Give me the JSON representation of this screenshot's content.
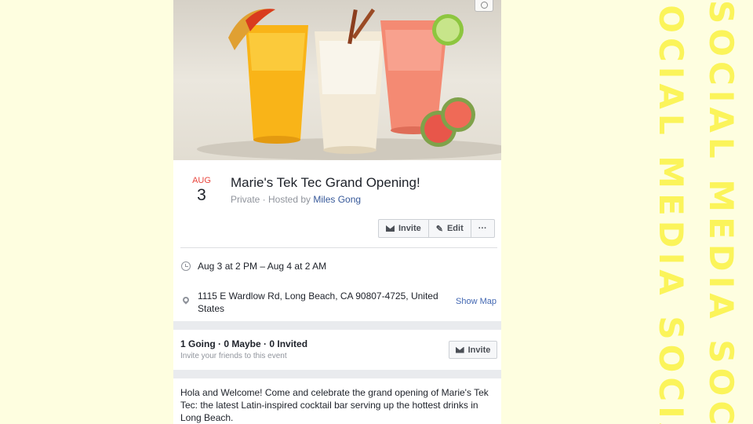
{
  "background": {
    "decorative_text": "SOCIAL MEDIA SOCIAL MEDIA SOCIAL MEDIA",
    "color": "#fbf45a"
  },
  "event": {
    "date": {
      "month": "AUG",
      "day": "3"
    },
    "title": "Marie's Tek Tec Grand Opening!",
    "privacy": "Private · Hosted by ",
    "host": "Miles Gong"
  },
  "actions": {
    "invite": "Invite",
    "edit": "Edit",
    "more": "···"
  },
  "details": {
    "time": "Aug 3 at 2 PM – Aug 4 at 2 AM",
    "address": "1115 E Wardlow Rd, Long Beach, CA 90807-4725, United States",
    "show_map": "Show Map"
  },
  "guests": {
    "summary": "1 Going · 0 Maybe · 0 Invited",
    "hint": "Invite your friends to this event",
    "invite_button": "Invite"
  },
  "description": "Hola and Welcome! Come and celebrate the grand opening of Marie's Tek Tec: the latest Latin-inspired cocktail bar serving up the hottest drinks in Long Beach.",
  "icons": [
    "camera-icon",
    "envelope-icon",
    "pencil-icon",
    "clock-icon",
    "map-pin-icon"
  ],
  "colors": {
    "accent": "#365899",
    "date_red": "#e9473f",
    "link": "#4267b2"
  }
}
